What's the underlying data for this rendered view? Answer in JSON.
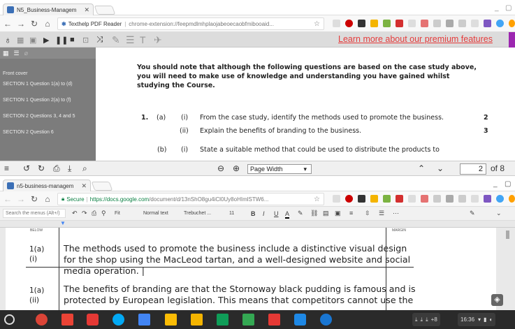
{
  "tab1": {
    "title": "N5_Business-Managem"
  },
  "addr1": {
    "ext_name": "Texthelp PDF Reader",
    "url": "chrome-extension://feepmdlmhplaojabeoecaobfmibooaid..."
  },
  "promo": "Learn more about our premium features",
  "pdf_sidebar": {
    "items": [
      "Front cover",
      "SECTION 1 Question 1(a) to (d)",
      "SECTION 1 Question 2(a) to (f)",
      "SECTION 2 Questions 3, 4 and 5",
      "SECTION 2 Question 6"
    ]
  },
  "pdf": {
    "intro": [
      "You should note that although the following questions are based on the case study above,",
      "you will need to make use of knowledge and understanding you have gained whilst",
      "studying the Course."
    ],
    "q1_num": "1.",
    "q1_a": "(a)",
    "q1_ai_num": "(i)",
    "q1_ai": "From the case study, identify the methods used to promote the business.",
    "q1_ai_marks": "2",
    "q1_aii_num": "(ii)",
    "q1_aii": "Explain the benefits of branding to the business.",
    "q1_aii_marks": "3",
    "q1_b": "(b)",
    "q1_bi_num": "(i)",
    "q1_bi": "State a suitable method that could be used to distribute the products to"
  },
  "pdf_toolbar": {
    "page_width": "Page Width",
    "page": "2",
    "of_pages": "of 8"
  },
  "tab2": {
    "title": "n5-business-managem"
  },
  "addr2": {
    "secure": "Secure",
    "url_host": "https://docs.google.com",
    "url_path": "/document/d/13nShO8gu4iCl0Uy8oHImlSTW6..."
  },
  "docs_toolbar": {
    "search": "Search the menus (Alt+/)",
    "fit": "Fit",
    "style": "Normal text",
    "font": "Trebuchet ...",
    "size": "11",
    "bold": "B",
    "italic": "I",
    "underline": "U",
    "font_color": "A"
  },
  "doc": {
    "col_below": "BELOW",
    "col_margin": "MARGIN",
    "row1_label": [
      "1(a)",
      "(i)"
    ],
    "row1_text": [
      " The methods used to promote the business include a distinctive visual design",
      "for the shop using the MacLeod tartan, and a well-designed website and social",
      "media operation. |"
    ],
    "row2_label": [
      "1(a)",
      "(ii)"
    ],
    "row2_text": [
      "The benefits of branding are that the Stornoway black pudding is famous and is",
      "protected by European legislation. This means that competitors cannot use the"
    ]
  },
  "taskbar": {
    "time": "16:36",
    "badge": "+8"
  },
  "colors": {
    "promo": "#e53b3b",
    "sidebar": "#7c7c7c",
    "taskbar": "#2a2a2a",
    "accent": "#4285f4"
  }
}
